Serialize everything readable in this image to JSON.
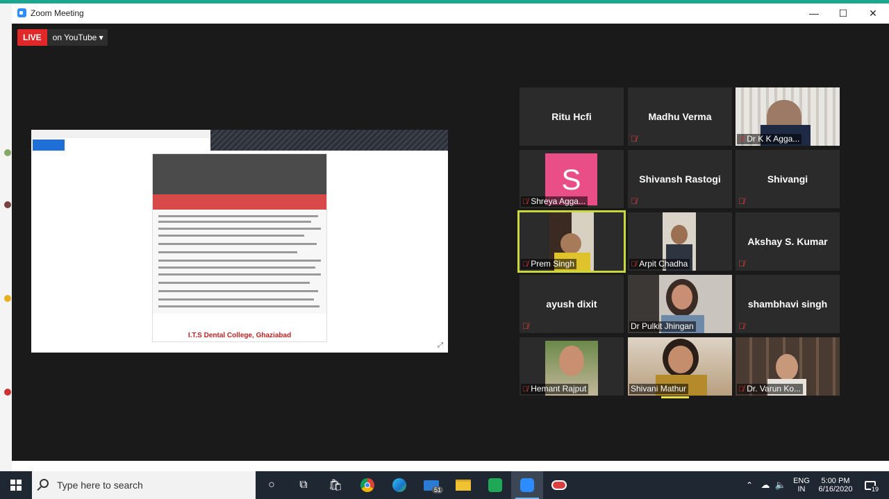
{
  "window": {
    "title": "Zoom Meeting",
    "minimize": "—",
    "maximize": "☐",
    "close": "✕"
  },
  "live": {
    "badge": "LIVE",
    "service": "on YouTube",
    "caret": "▾"
  },
  "share": {
    "poster_footer": "I.T.S Dental College, Ghaziabad"
  },
  "participants": [
    {
      "name": "Ritu Hcfi"
    },
    {
      "name": "Madhu Verma"
    },
    {
      "label": "Dr K K Agga..."
    },
    {
      "label": "Shreya Agga...",
      "avatar_letter": "S",
      "avatar_color": "#e94f86"
    },
    {
      "name": "Shivansh Rastogi"
    },
    {
      "name": "Shivangi"
    },
    {
      "label": "Prem Singh"
    },
    {
      "label": "Arpit Chadha"
    },
    {
      "name": "Akshay S. Kumar"
    },
    {
      "name": "ayush dixit"
    },
    {
      "label": "Dr Pulkit Jhingan"
    },
    {
      "name": "shambhavi singh"
    },
    {
      "label": "Hemant Rajput"
    },
    {
      "label": "Shivani Mathur"
    },
    {
      "label": "Dr. Varun Ko..."
    }
  ],
  "taskbar": {
    "search_placeholder": "Type here to search",
    "mail_badge": "51",
    "language": "ENG",
    "region": "IN",
    "time": "5:00 PM",
    "date": "6/16/2020",
    "notifications": "19"
  },
  "colors": {
    "live_red": "#e02828",
    "speaker_border": "#c9d93a",
    "muted_mic": "#e03c3c",
    "taskbar": "#1f2733"
  }
}
